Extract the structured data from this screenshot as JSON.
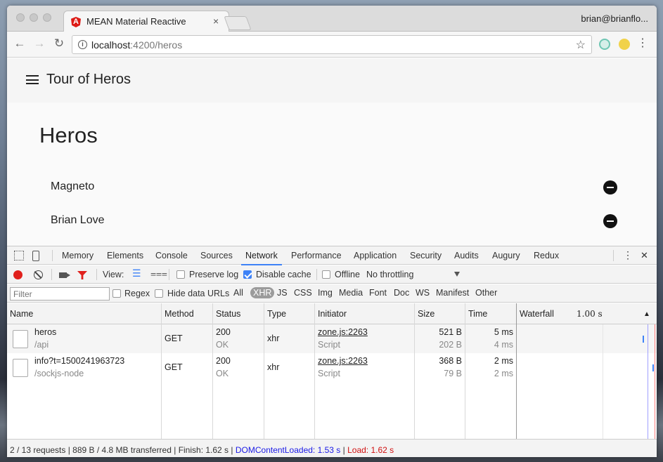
{
  "browser": {
    "tab_title": "MEAN Material Reactive",
    "tab_close": "×",
    "user": "brian@brianflo...",
    "url_host": "localhost",
    "url_path": ":4200/heros",
    "back": "←",
    "forward": "→",
    "reload": "↻",
    "star": "☆",
    "menu": "⋮"
  },
  "app": {
    "title": "Tour of Heros",
    "heading": "Heros",
    "heroes": [
      "Magneto",
      "Brian Love"
    ]
  },
  "devtools": {
    "tabs": [
      "Memory",
      "Elements",
      "Console",
      "Sources",
      "Network",
      "Performance",
      "Application",
      "Security",
      "Audits",
      "Augury",
      "Redux"
    ],
    "active_tab": "Network",
    "more": "⋮",
    "close": "✕",
    "view_label": "View:",
    "preserve_log": "Preserve log",
    "disable_cache": "Disable cache",
    "offline": "Offline",
    "throttling": "No throttling",
    "filter_placeholder": "Filter",
    "regex": "Regex",
    "hide_data_urls": "Hide data URLs",
    "types": [
      "All",
      "XHR",
      "JS",
      "CSS",
      "Img",
      "Media",
      "Font",
      "Doc",
      "WS",
      "Manifest",
      "Other"
    ],
    "selected_type": "XHR",
    "columns": [
      "Name",
      "Method",
      "Status",
      "Type",
      "Initiator",
      "Size",
      "Time",
      "Waterfall"
    ],
    "waterfall_time": "1.00 s",
    "sort_arrow": "▲",
    "rows": [
      {
        "name": "heros",
        "path": "/api",
        "method": "GET",
        "status": "200",
        "status_text": "OK",
        "type": "xhr",
        "initiator": "zone.js:2263",
        "initiator_type": "Script",
        "size": "521 B",
        "content_size": "202 B",
        "time": "5 ms",
        "latency": "4 ms"
      },
      {
        "name": "info?t=1500241963723",
        "path": "/sockjs-node",
        "method": "GET",
        "status": "200",
        "status_text": "OK",
        "type": "xhr",
        "initiator": "zone.js:2263",
        "initiator_type": "Script",
        "size": "368 B",
        "content_size": "79 B",
        "time": "2 ms",
        "latency": "2 ms"
      }
    ],
    "summary": "2 / 13 requests | 889 B / 4.8 MB transferred | Finish: 1.62 s |",
    "dcl": "DOMContentLoaded: 1.53 s",
    "sep": "|",
    "load": "Load: 1.62 s"
  },
  "colors": {
    "accent": "#3e82f7",
    "record": "#e0201c",
    "dcl": "#1a1ae6",
    "load": "#d01010"
  }
}
